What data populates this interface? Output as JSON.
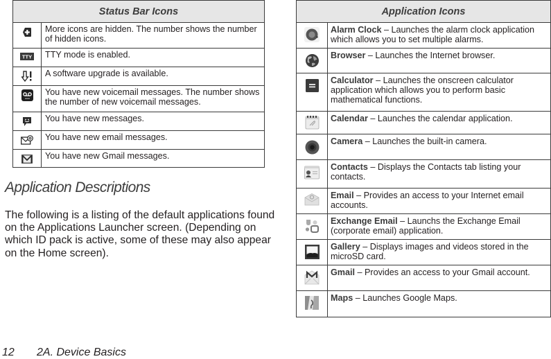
{
  "status_bar_table": {
    "title": "Status Bar Icons",
    "rows": [
      {
        "icon": "more-icons-hidden-icon",
        "text": "More icons are hidden. The number shows the number of hidden icons."
      },
      {
        "icon": "tty-icon",
        "icon_label": "TTY",
        "text": "TTY mode is enabled."
      },
      {
        "icon": "software-upgrade-icon",
        "text": "A software upgrade is available."
      },
      {
        "icon": "voicemail-icon",
        "text": "You have new voicemail messages. The number shows the number of new voicemail messages."
      },
      {
        "icon": "new-message-icon",
        "text": "You have new messages."
      },
      {
        "icon": "new-email-icon",
        "text": "You have new email messages."
      },
      {
        "icon": "new-gmail-icon",
        "text": "You have new Gmail messages."
      }
    ]
  },
  "section": {
    "title": "Application Descriptions",
    "body": "The following is a listing of the default applications found on the Applications Launcher screen. (Depending on which ID pack is active, some of these may also appear on the Home screen)."
  },
  "app_table": {
    "title": "Application Icons",
    "separator": " – ",
    "rows": [
      {
        "icon": "alarm-clock-icon",
        "name": "Alarm Clock",
        "desc": "Launches the alarm clock application which allows you to set multiple alarms."
      },
      {
        "icon": "browser-icon",
        "name": "Browser",
        "desc": "Launches the Internet browser."
      },
      {
        "icon": "calculator-icon",
        "name": "Calculator",
        "desc": "Launches the onscreen calculator application which allows you to perform basic mathematical functions."
      },
      {
        "icon": "calendar-icon",
        "name": "Calendar",
        "desc": "Launches the calendar application."
      },
      {
        "icon": "camera-icon",
        "name": "Camera",
        "desc": "Launches the built-in camera."
      },
      {
        "icon": "contacts-icon",
        "name": "Contacts",
        "desc": "Displays the Contacts tab listing your contacts."
      },
      {
        "icon": "email-icon",
        "name": "Email",
        "desc": "Provides an access to your Internet email accounts."
      },
      {
        "icon": "exchange-email-icon",
        "name": "Exchange Email",
        "desc": "Launchs the Exchange Email (corporate email) application."
      },
      {
        "icon": "gallery-icon",
        "name": "Gallery",
        "desc": "Displays images and videos stored in the microSD card."
      },
      {
        "icon": "gmail-icon",
        "name": "Gmail",
        "desc": "Provides an access to your Gmail account."
      },
      {
        "icon": "maps-icon",
        "name": "Maps",
        "desc": "Launches Google Maps."
      }
    ]
  },
  "footer": {
    "page_number": "12",
    "chapter": "2A. Device Basics"
  }
}
